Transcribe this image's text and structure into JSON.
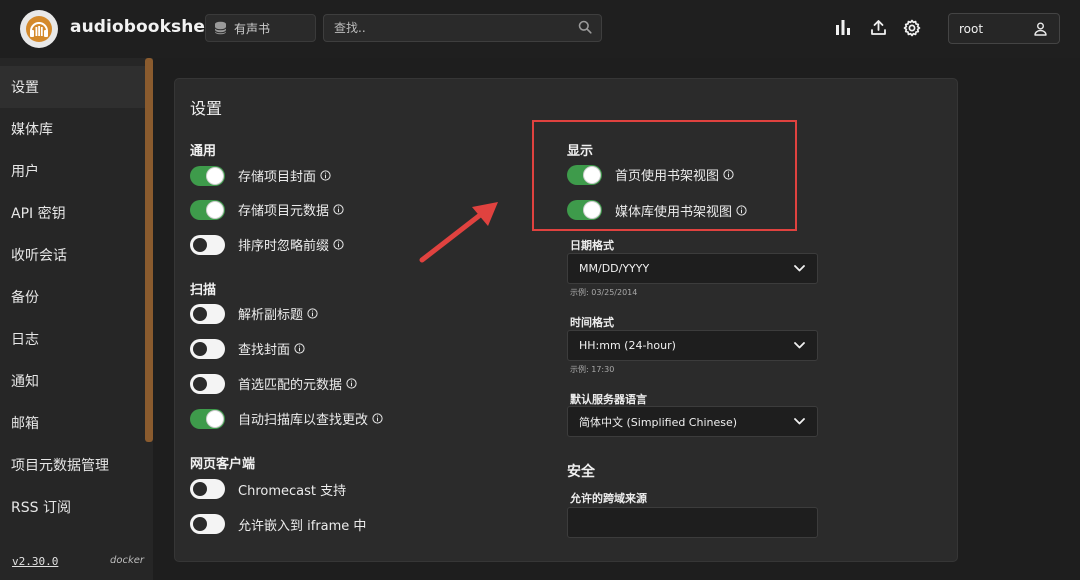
{
  "header": {
    "app_name": "audiobookshelf",
    "library_name": "有声书",
    "search_placeholder": "查找..",
    "user_name": "root"
  },
  "sidebar": {
    "items": [
      {
        "label": "设置",
        "active": true
      },
      {
        "label": "媒体库"
      },
      {
        "label": "用户"
      },
      {
        "label": "API 密钥"
      },
      {
        "label": "收听会话"
      },
      {
        "label": "备份"
      },
      {
        "label": "日志"
      },
      {
        "label": "通知"
      },
      {
        "label": "邮箱"
      },
      {
        "label": "项目元数据管理"
      },
      {
        "label": "RSS 订阅"
      }
    ],
    "version": "v2.30.0",
    "platform": "docker"
  },
  "settings": {
    "title": "设置",
    "general": {
      "heading": "通用",
      "options": [
        {
          "label": "存储项目封面",
          "enabled": true
        },
        {
          "label": "存储项目元数据",
          "enabled": true
        },
        {
          "label": "排序时忽略前缀",
          "enabled": false
        }
      ]
    },
    "scan": {
      "heading": "扫描",
      "options": [
        {
          "label": "解析副标题",
          "enabled": false
        },
        {
          "label": "查找封面",
          "enabled": false
        },
        {
          "label": "首选匹配的元数据",
          "enabled": false
        },
        {
          "label": "自动扫描库以查找更改",
          "enabled": true
        }
      ]
    },
    "web_client": {
      "heading": "网页客户端",
      "options": [
        {
          "label": "Chromecast 支持",
          "enabled": false
        },
        {
          "label": "允许嵌入到 iframe 中",
          "enabled": false
        }
      ]
    },
    "display": {
      "heading": "显示",
      "options": [
        {
          "label": "首页使用书架视图",
          "enabled": true
        },
        {
          "label": "媒体库使用书架视图",
          "enabled": true
        }
      ],
      "date_format": {
        "label": "日期格式",
        "value": "MM/DD/YYYY",
        "example": "示例: 03/25/2014"
      },
      "time_format": {
        "label": "时间格式",
        "value": "HH:mm (24-hour)",
        "example": "示例: 17:30"
      },
      "server_language": {
        "label": "默认服务器语言",
        "value": "简体中文 (Simplified Chinese)"
      }
    },
    "security": {
      "heading": "安全",
      "cors_label": "允许的跨域来源",
      "cors_value": ""
    }
  },
  "colors": {
    "toggle_on": "#3e9b4b",
    "annotation": "#e0423f",
    "sidebar_scroll": "#8a5b2e"
  }
}
